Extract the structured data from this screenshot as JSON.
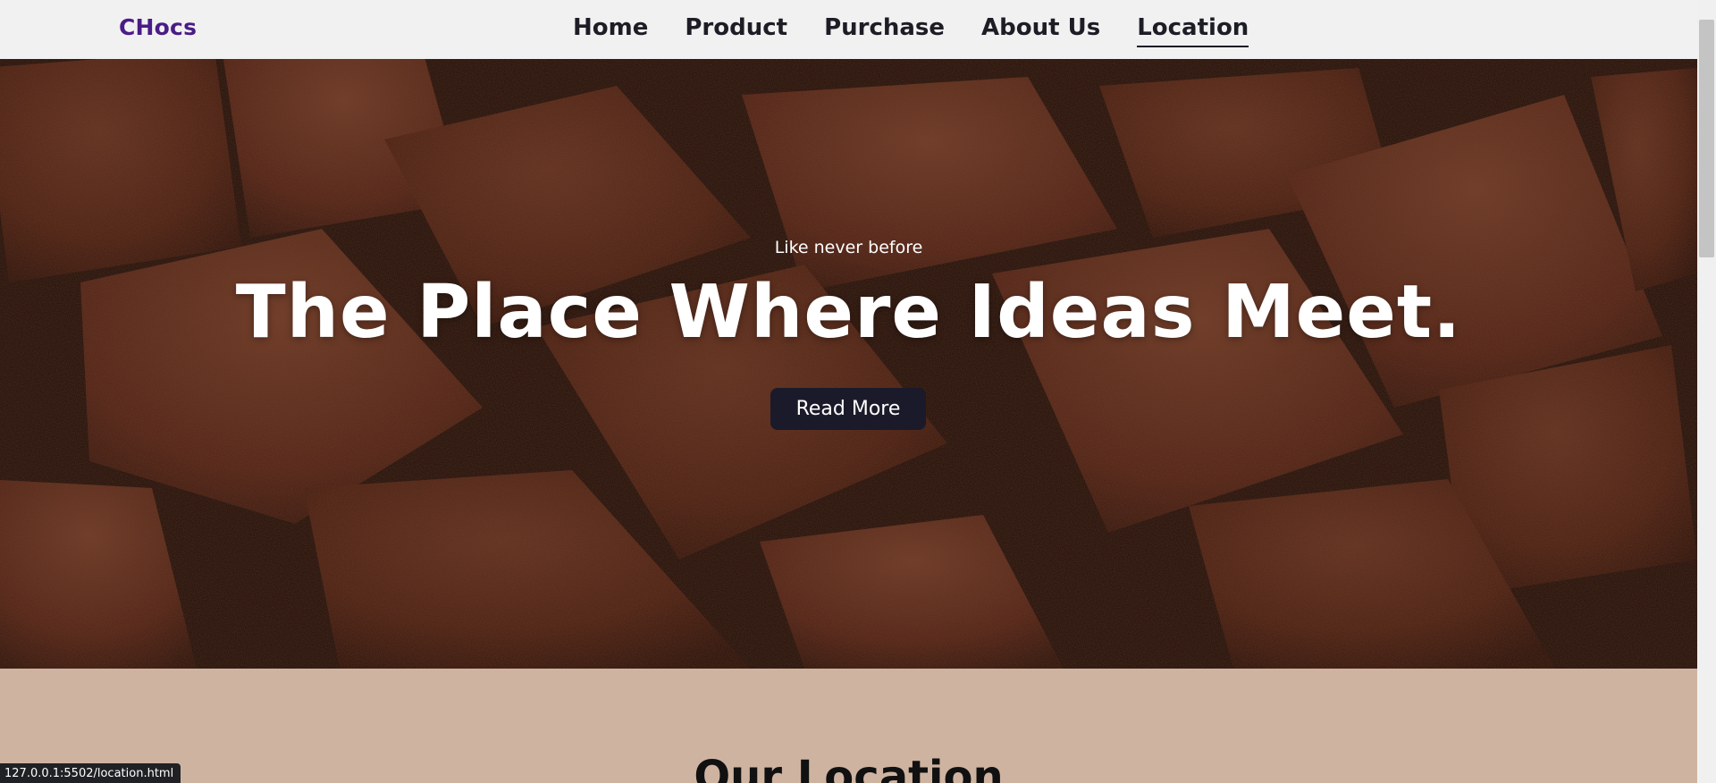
{
  "brand": "CHocs",
  "nav": {
    "items": [
      {
        "label": "Home"
      },
      {
        "label": "Product"
      },
      {
        "label": "Purchase"
      },
      {
        "label": "About Us"
      },
      {
        "label": "Location"
      }
    ],
    "active": "Location"
  },
  "hero": {
    "kicker": "Like never before",
    "title": "The Place Where Ideas Meet.",
    "button": "Read More",
    "background": "chocolate-truffles-image"
  },
  "location": {
    "title": "Our Location"
  },
  "status": {
    "url": "127.0.0.1:5502/location.html"
  },
  "colors": {
    "brand": "#4a1c86",
    "nav_text": "#1d1d26",
    "button_bg": "#1a1a2a",
    "section_bg": "#cfb3a1"
  }
}
